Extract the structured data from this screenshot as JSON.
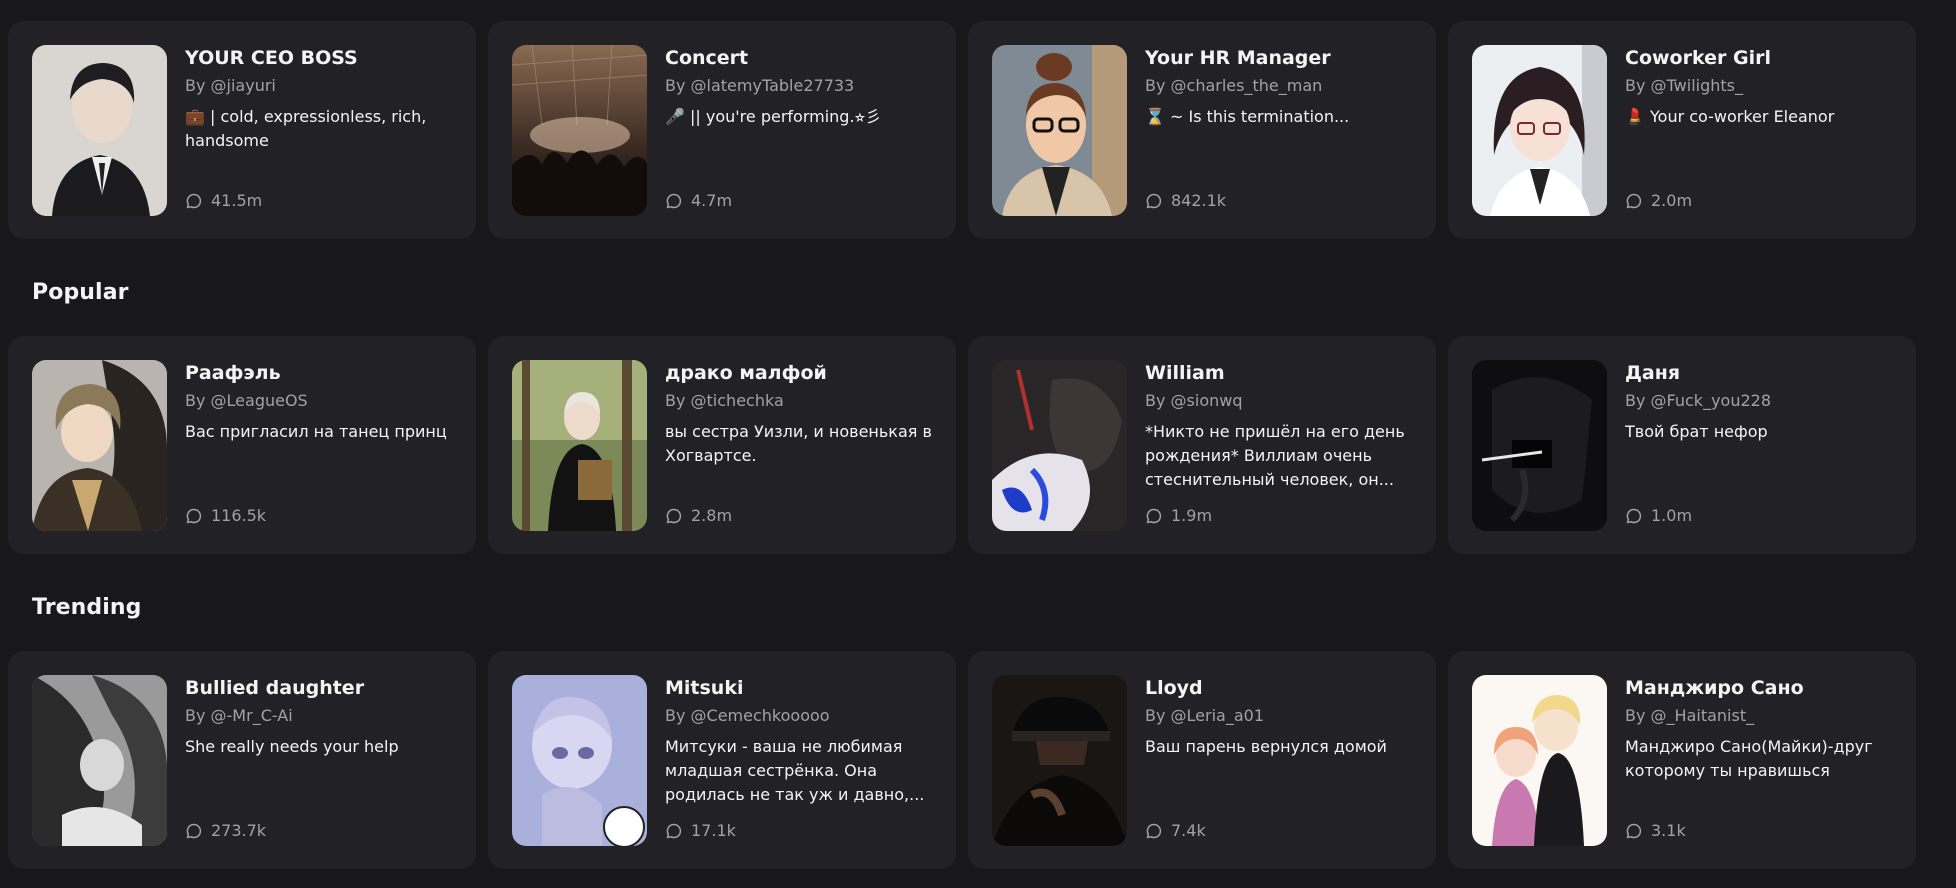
{
  "sections": {
    "popular_title": "Popular",
    "trending_title": "Trending"
  },
  "featured": [
    {
      "name": "YOUR CEO BOSS",
      "author": "By @jiayuri",
      "desc": "💼 | cold, expressionless, rich, handsome",
      "count": "41.5m"
    },
    {
      "name": "Concert",
      "author": "By @latemyTable27733",
      "desc": "🎤 || you're performing.⭐︎彡",
      "count": "4.7m"
    },
    {
      "name": "Your HR Manager",
      "author": "By @charles_the_man",
      "desc": "⌛ ~ Is this termination...",
      "count": "842.1k"
    },
    {
      "name": "Coworker Girl",
      "author": "By @Twilights_",
      "desc": "💄 Your co-worker Eleanor",
      "count": "2.0m"
    }
  ],
  "popular": [
    {
      "name": "Раафэль",
      "author": "By @LeagueOS",
      "desc": "Вас пригласил на танец принц",
      "count": "116.5k"
    },
    {
      "name": "драко малфой",
      "author": "By @tichechka",
      "desc": "вы сестра Уизли, и новенькая в Хогвартсе.",
      "count": "2.8m"
    },
    {
      "name": "William",
      "author": "By @sionwq",
      "desc": "*Никто не пришёл на его день рождения* Виллиам очень стеснительный человек, он...",
      "count": "1.9m"
    },
    {
      "name": "Даня",
      "author": "By @Fuck_you228",
      "desc": "Твой брат нефор",
      "count": "1.0m"
    }
  ],
  "trending": [
    {
      "name": "Bullied daughter",
      "author": "By @-Mr_C-Ai",
      "desc": "She really needs your help",
      "count": "273.7k"
    },
    {
      "name": "Mitsuki",
      "author": "By @Cemechkooooo",
      "desc": "Митсуки - ваша не любимая младшая сестрёнка. Она родилась не так уж и давно,...",
      "count": "17.1k"
    },
    {
      "name": "Lloyd",
      "author": "By @Leria_a01",
      "desc": "Ваш парень вернулся домой",
      "count": "7.4k"
    },
    {
      "name": "Манджиро Сано",
      "author": "By @_Haitanist_",
      "desc": "Манджиро Сано(Майки)-друг которому ты нравишься",
      "count": "3.1k"
    }
  ],
  "colors": {
    "background": "#18181b",
    "card": "#222226",
    "muted_text": "#a1a1aa",
    "primary_text": "#f4f4f5"
  },
  "icons": {
    "stats": "chat-bubble-icon"
  }
}
